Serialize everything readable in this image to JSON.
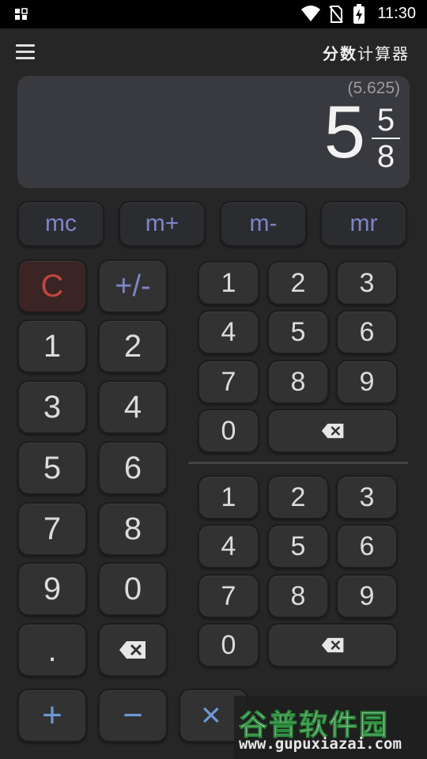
{
  "status_bar": {
    "time": "11:30",
    "icons": [
      "grid-notification-icon",
      "wifi-icon",
      "no-sim-icon",
      "battery-charging-icon"
    ]
  },
  "app_bar": {
    "title_bold": "分数",
    "title_rest": "计算器",
    "menu_icon": "hamburger-menu-icon"
  },
  "display": {
    "decimal": "(5.625)",
    "whole": "5",
    "numerator": "5",
    "denominator": "8"
  },
  "memory": {
    "mc": "mc",
    "m_plus": "m+",
    "m_minus": "m-",
    "mr": "mr"
  },
  "left_pad": {
    "clear": "C",
    "sign": "+/-",
    "digits": [
      "1",
      "2",
      "3",
      "4",
      "5",
      "6",
      "7",
      "8",
      "9",
      "0"
    ],
    "dot": ".",
    "backspace_icon": "backspace-icon"
  },
  "numerator_pad": {
    "digits": [
      "1",
      "2",
      "3",
      "4",
      "5",
      "6",
      "7",
      "8",
      "9",
      "0"
    ],
    "backspace_icon": "backspace-icon"
  },
  "denominator_pad": {
    "digits": [
      "1",
      "2",
      "3",
      "4",
      "5",
      "6",
      "7",
      "8",
      "9",
      "0"
    ],
    "backspace_icon": "backspace-icon"
  },
  "operators": {
    "add": "+",
    "subtract": "−",
    "multiply": "×"
  },
  "watermark": {
    "name": "谷普软件园",
    "url": "www.gupuxiazai.com"
  },
  "colors": {
    "background": "#262626",
    "display": "#393a3f",
    "memory_text": "#7d86c9",
    "clear_text": "#c0463f",
    "operator_text": "#6d9ad7"
  }
}
